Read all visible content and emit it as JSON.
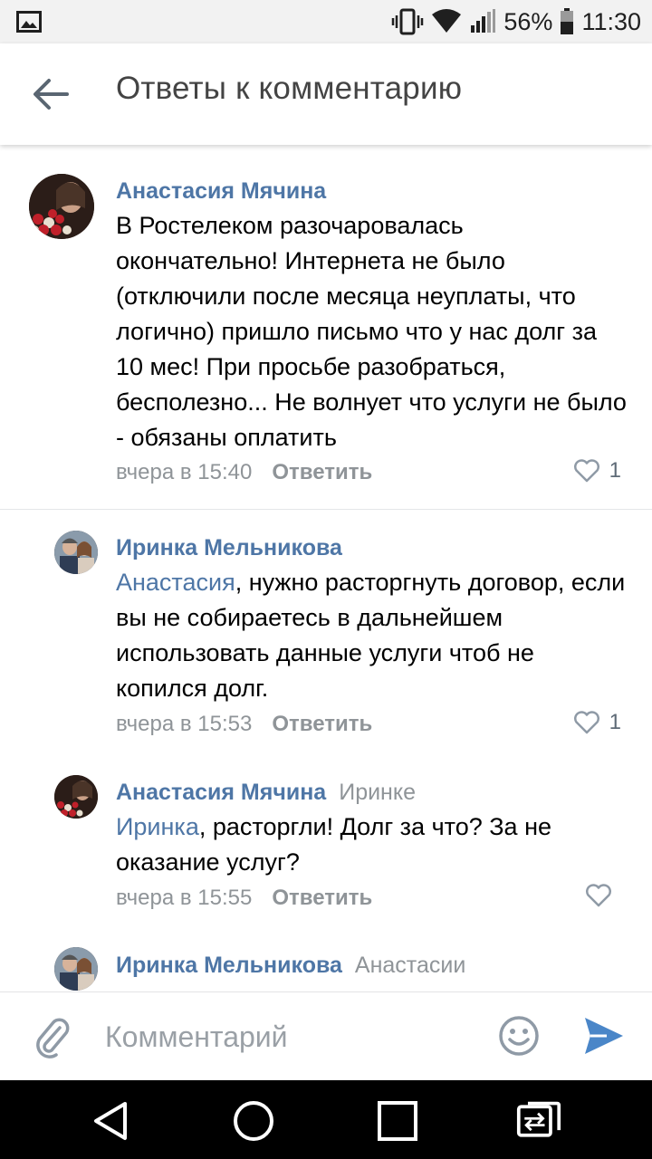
{
  "status_bar": {
    "battery": "56%",
    "time": "11:30"
  },
  "header": {
    "title": "Ответы к комментарию"
  },
  "comments": [
    {
      "author": "Анастасия Мячина",
      "reply_to": "",
      "mention": "",
      "text": "В Ростелеком разочаровалась окончательно! Интернета не было (отключили после месяца неуплаты, что логично) пришло письмо что у нас долг за 10 мес! При просьбе разобраться, бесполезно... Не волнует что услуги не было - обязаны оплатить",
      "time": "вчера в 15:40",
      "reply_label": "Ответить",
      "likes": "1"
    },
    {
      "author": "Иринка Мельникова",
      "reply_to": "",
      "mention": "Анастасия",
      "text": ", нужно расторгнуть договор, если вы не собираетесь в дальнейшем использовать данные услуги чтоб не копился долг.",
      "time": "вчера в 15:53",
      "reply_label": "Ответить",
      "likes": "1"
    },
    {
      "author": "Анастасия Мячина",
      "reply_to": "Иринке",
      "mention": "Иринка",
      "text": ", расторгли! Долг за что? За не оказание услуг?",
      "time": "вчера в 15:55",
      "reply_label": "Ответить",
      "likes": ""
    },
    {
      "author": "Иринка Мельникова",
      "reply_to": "Анастасии",
      "mention": "",
      "text": "",
      "time": "",
      "reply_label": "",
      "likes": ""
    }
  ],
  "input": {
    "placeholder": "Комментарий"
  },
  "colors": {
    "accent": "#4e76a6",
    "secondary_text": "#8f9498",
    "send": "#4a86c8"
  }
}
